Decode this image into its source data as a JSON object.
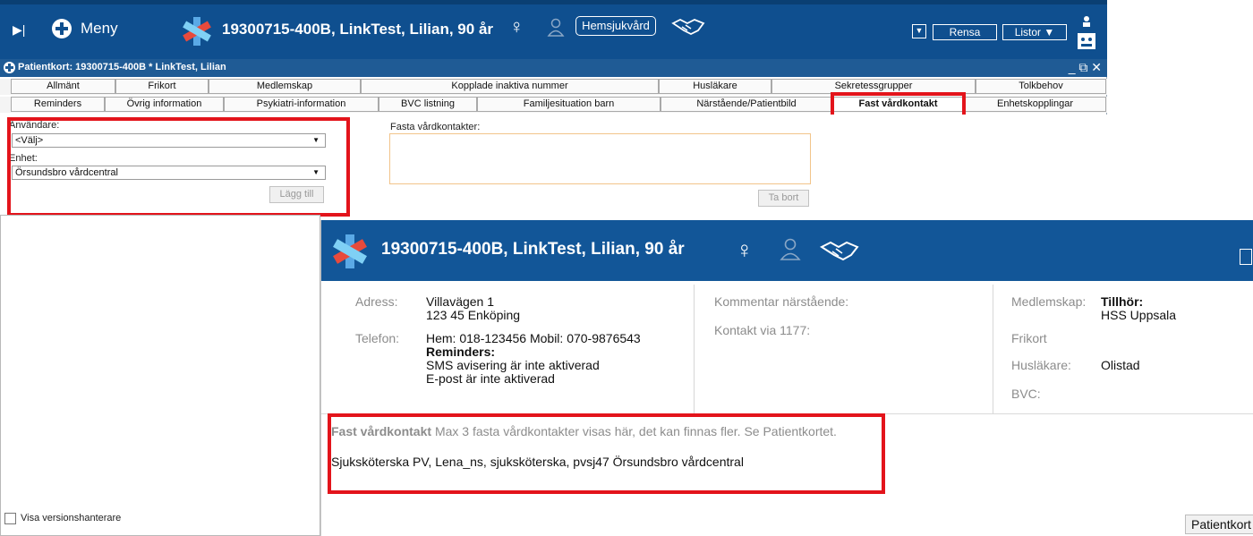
{
  "topbar": {
    "menu_label": "Meny",
    "patient": "19300715-400B, LinkTest, Lilian, 90 år",
    "care_badge": "Hemsjukvård",
    "rensa_label": "Rensa",
    "listor_label": "Listor"
  },
  "window": {
    "title": "Patientkort: 19300715-400B * LinkTest, Lilian"
  },
  "tabs_row1": [
    "Allmänt",
    "Frikort",
    "Medlemskap",
    "Kopplade inaktiva nummer",
    "Husläkare",
    "Sekretessgrupper",
    "Tolkbehov"
  ],
  "tabs_row2": [
    "Reminders",
    "Övrig information",
    "Psykiatri-information",
    "BVC listning",
    "Familjesituation barn",
    "Närstående/Patientbild",
    "Fast vårdkontakt",
    "Enhetskopplingar"
  ],
  "form": {
    "user_label": "Användare:",
    "user_value": "<Välj>",
    "unit_label": "Enhet:",
    "unit_value": "Örsundsbro vårdcentral",
    "add_button": "Lägg till",
    "contacts_label": "Fasta vårdkontakter:",
    "remove_button": "Ta bort",
    "version_checkbox": "Visa versionshanterare"
  },
  "overlay": {
    "patient": "19300715-400B,  LinkTest, Lilian,  90 år",
    "address_label": "Adress:",
    "address_line1": "Villavägen 1",
    "address_line2": "123 45 Enköping",
    "phone_label": "Telefon:",
    "phone_value": "Hem: 018-123456 Mobil: 070-9876543",
    "reminders_title": "Reminders:",
    "reminder_sms": "SMS avisering är inte aktiverad",
    "reminder_email": "E-post är inte aktiverad",
    "comment_label": "Kommentar närstående:",
    "contact_1177_label": "Kontakt via 1177:",
    "membership_label": "Medlemskap:",
    "membership_title": "Tillhör:",
    "membership_value": "HSS Uppsala",
    "frikort_label": "Frikort",
    "gp_label": "Husläkare:",
    "gp_value": "Olistad",
    "bvc_label": "BVC:",
    "fast_title": "Fast vårdkontakt",
    "fast_note": "Max 3 fasta vårdkontakter visas här, det kan finnas fler. Se Patientkortet.",
    "fast_entry": "Sjuksköterska PV, Lena_ns, sjuksköterska, pvsj47 Örsundsbro vårdcentral",
    "patientkort_button": "Patientkort"
  },
  "colors": {
    "header_blue": "#0f4f8f",
    "highlight_red": "#e3141b",
    "input_orange_border": "#f2c48a"
  }
}
